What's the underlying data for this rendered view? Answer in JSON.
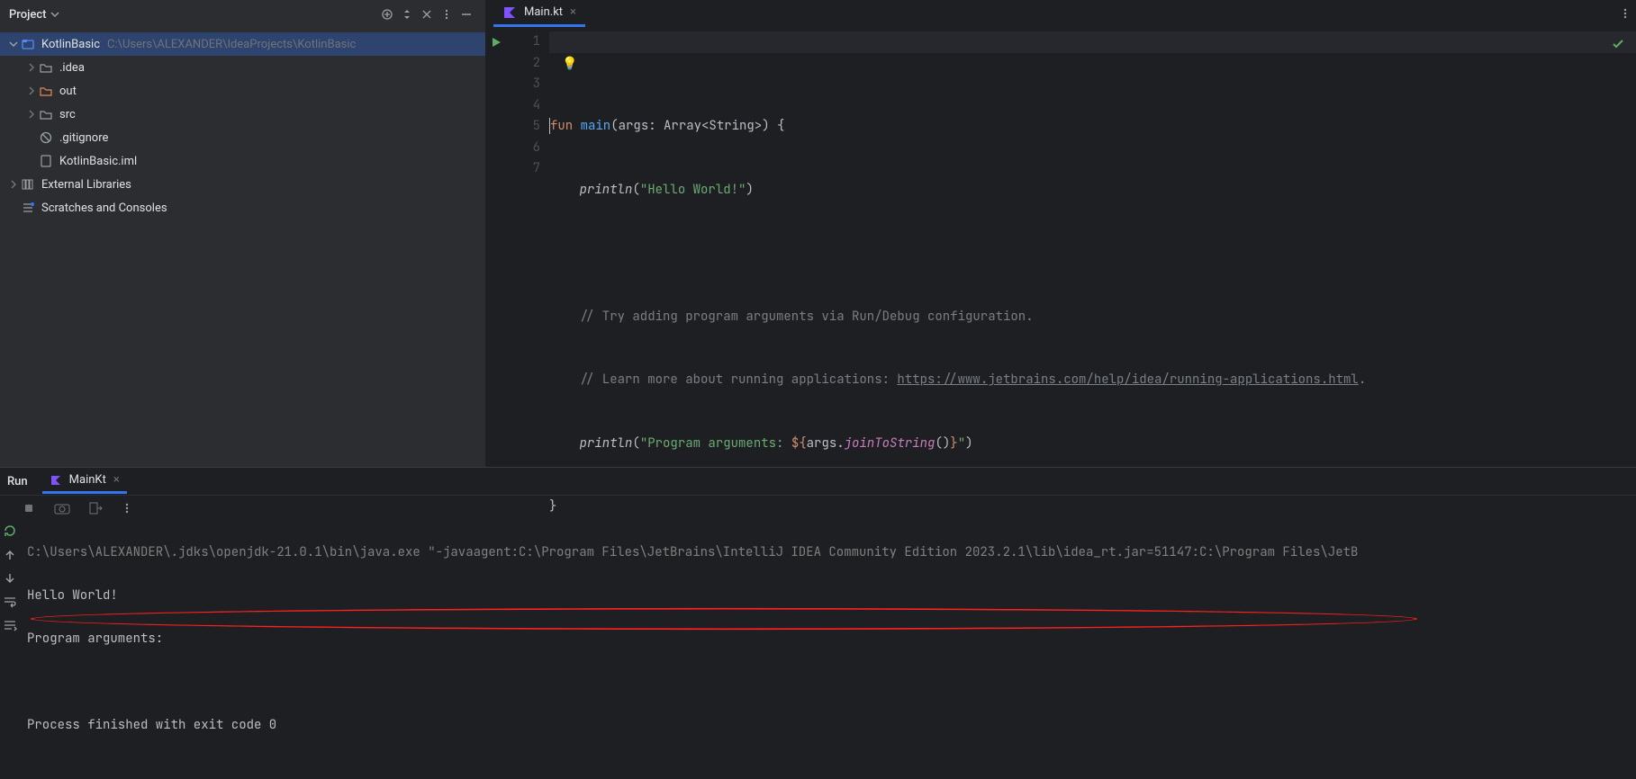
{
  "project_panel": {
    "title": "Project",
    "root": {
      "name": "KotlinBasic",
      "path": "C:\\Users\\ALEXANDER\\IdeaProjects\\KotlinBasic"
    },
    "items": [
      {
        "name": ".idea",
        "kind": "folder",
        "expandable": true
      },
      {
        "name": "out",
        "kind": "folder-orange",
        "expandable": true
      },
      {
        "name": "src",
        "kind": "folder",
        "expandable": true
      },
      {
        "name": ".gitignore",
        "kind": "gitignore",
        "expandable": false
      },
      {
        "name": "KotlinBasic.iml",
        "kind": "iml",
        "expandable": false
      }
    ],
    "external_libraries": "External Libraries",
    "scratches": "Scratches and Consoles"
  },
  "editor": {
    "tab_label": "Main.kt",
    "lines": [
      "1",
      "2",
      "3",
      "4",
      "5",
      "6",
      "7"
    ],
    "code": {
      "l1_kw": "fun",
      "l1_fn": "main",
      "l1_rest": "(args: Array<String>) {",
      "l2_fn": "println",
      "l2_open": "(",
      "l2_str": "\"Hello World!\"",
      "l2_close": ")",
      "l4_cmt": "// Try adding program arguments via Run/Debug configuration.",
      "l5_cmt": "// Learn more about running applications: ",
      "l5_lnk": "https://www.jetbrains.com/help/idea/running-applications.html",
      "l5_dot": ".",
      "l6_fn": "println",
      "l6_open": "(",
      "l6_str1": "\"Program arguments: ",
      "l6_tpl_open": "${",
      "l6_args": "args",
      "l6_dot": ".",
      "l6_join": "joinToString",
      "l6_paren": "()",
      "l6_tpl_close": "}",
      "l6_str2": "\"",
      "l6_close": ")",
      "l7_brace": "}"
    }
  },
  "run": {
    "label": "Run",
    "tab": "MainKt",
    "console": {
      "cmd": "C:\\Users\\ALEXANDER\\.jdks\\openjdk-21.0.1\\bin\\java.exe \"-javaagent:C:\\Program Files\\JetBrains\\IntelliJ IDEA Community Edition 2023.2.1\\lib\\idea_rt.jar=51147:C:\\Program Files\\JetB",
      "out1": "Hello World!",
      "out2": "Program arguments: ",
      "exit": "Process finished with exit code 0"
    }
  }
}
